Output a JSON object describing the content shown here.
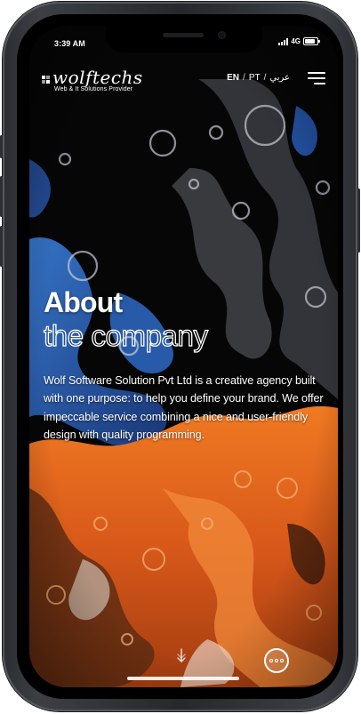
{
  "status_bar": {
    "time": "3:39 AM",
    "network": "4G"
  },
  "header": {
    "logo_text": "wolftechs",
    "logo_tagline": "Web & It Solutions Provider",
    "languages": [
      "EN",
      "PT",
      "عربي"
    ],
    "active_language": "EN",
    "menu_icon": "hamburger-menu-icon"
  },
  "hero": {
    "title": "About",
    "subtitle": "the company",
    "description": "Wolf Software Solution Pvt Ltd is a creative agency built with one purpose: to help you define your brand. We offer impeccable service combining a nice and user-friendly design with quality programming."
  },
  "controls": {
    "scroll_icon": "scroll-down-arrow-icon",
    "more_icon": "more-dots-icon"
  },
  "colors": {
    "frame": "#2b2d31",
    "accent_orange": "#e06a1c",
    "accent_blue": "#2f6fd1",
    "text": "#ffffff"
  }
}
